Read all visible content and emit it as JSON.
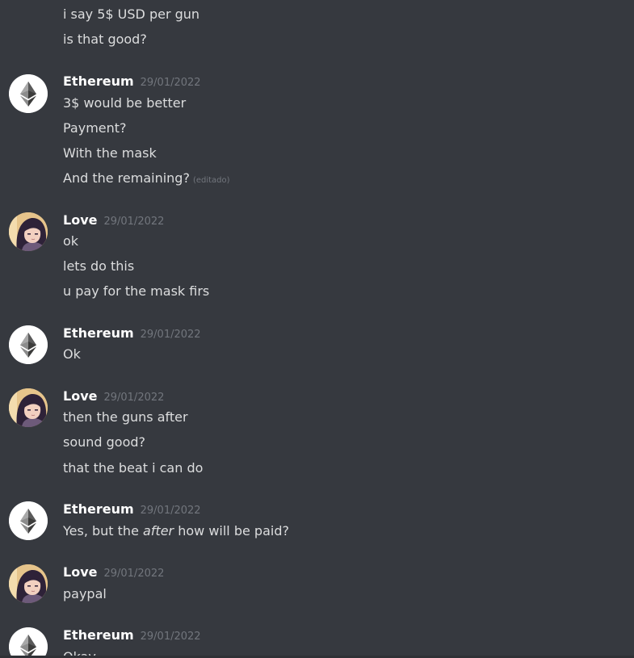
{
  "messages": {
    "top": {
      "lines": [
        "i say 5$ USD per gun",
        "is that good?"
      ]
    },
    "g1": {
      "author": "Ethereum",
      "time": "29/01/2022",
      "lines": [
        "3$ would be better",
        "Payment?",
        "With the mask",
        "And the remaining?"
      ],
      "edited": "(editado)"
    },
    "g2": {
      "author": "Love",
      "time": "29/01/2022",
      "lines": [
        "ok",
        "lets do this",
        "u pay for the mask firs"
      ]
    },
    "g3": {
      "author": "Ethereum",
      "time": "29/01/2022",
      "lines": [
        "Ok"
      ]
    },
    "g4": {
      "author": "Love",
      "time": "29/01/2022",
      "lines": [
        "then the guns after",
        "sound good?",
        "that the beat i can do"
      ]
    },
    "g5": {
      "author": "Ethereum",
      "time": "29/01/2022",
      "line_before": "Yes, but the ",
      "line_italic": "after",
      "line_after": " how will be paid?"
    },
    "g6": {
      "author": "Love",
      "time": "29/01/2022",
      "lines": [
        "paypal"
      ]
    },
    "g7": {
      "author": "Ethereum",
      "time": "29/01/2022",
      "lines": [
        "Okay"
      ]
    }
  },
  "icons": {
    "ethereum_avatar": "ethereum-logo-icon",
    "love_avatar": "anime-girl-avatar"
  },
  "colors": {
    "background": "#36393f",
    "username": "#ffffff",
    "text": "#dcddde",
    "timestamp": "#72767d"
  }
}
